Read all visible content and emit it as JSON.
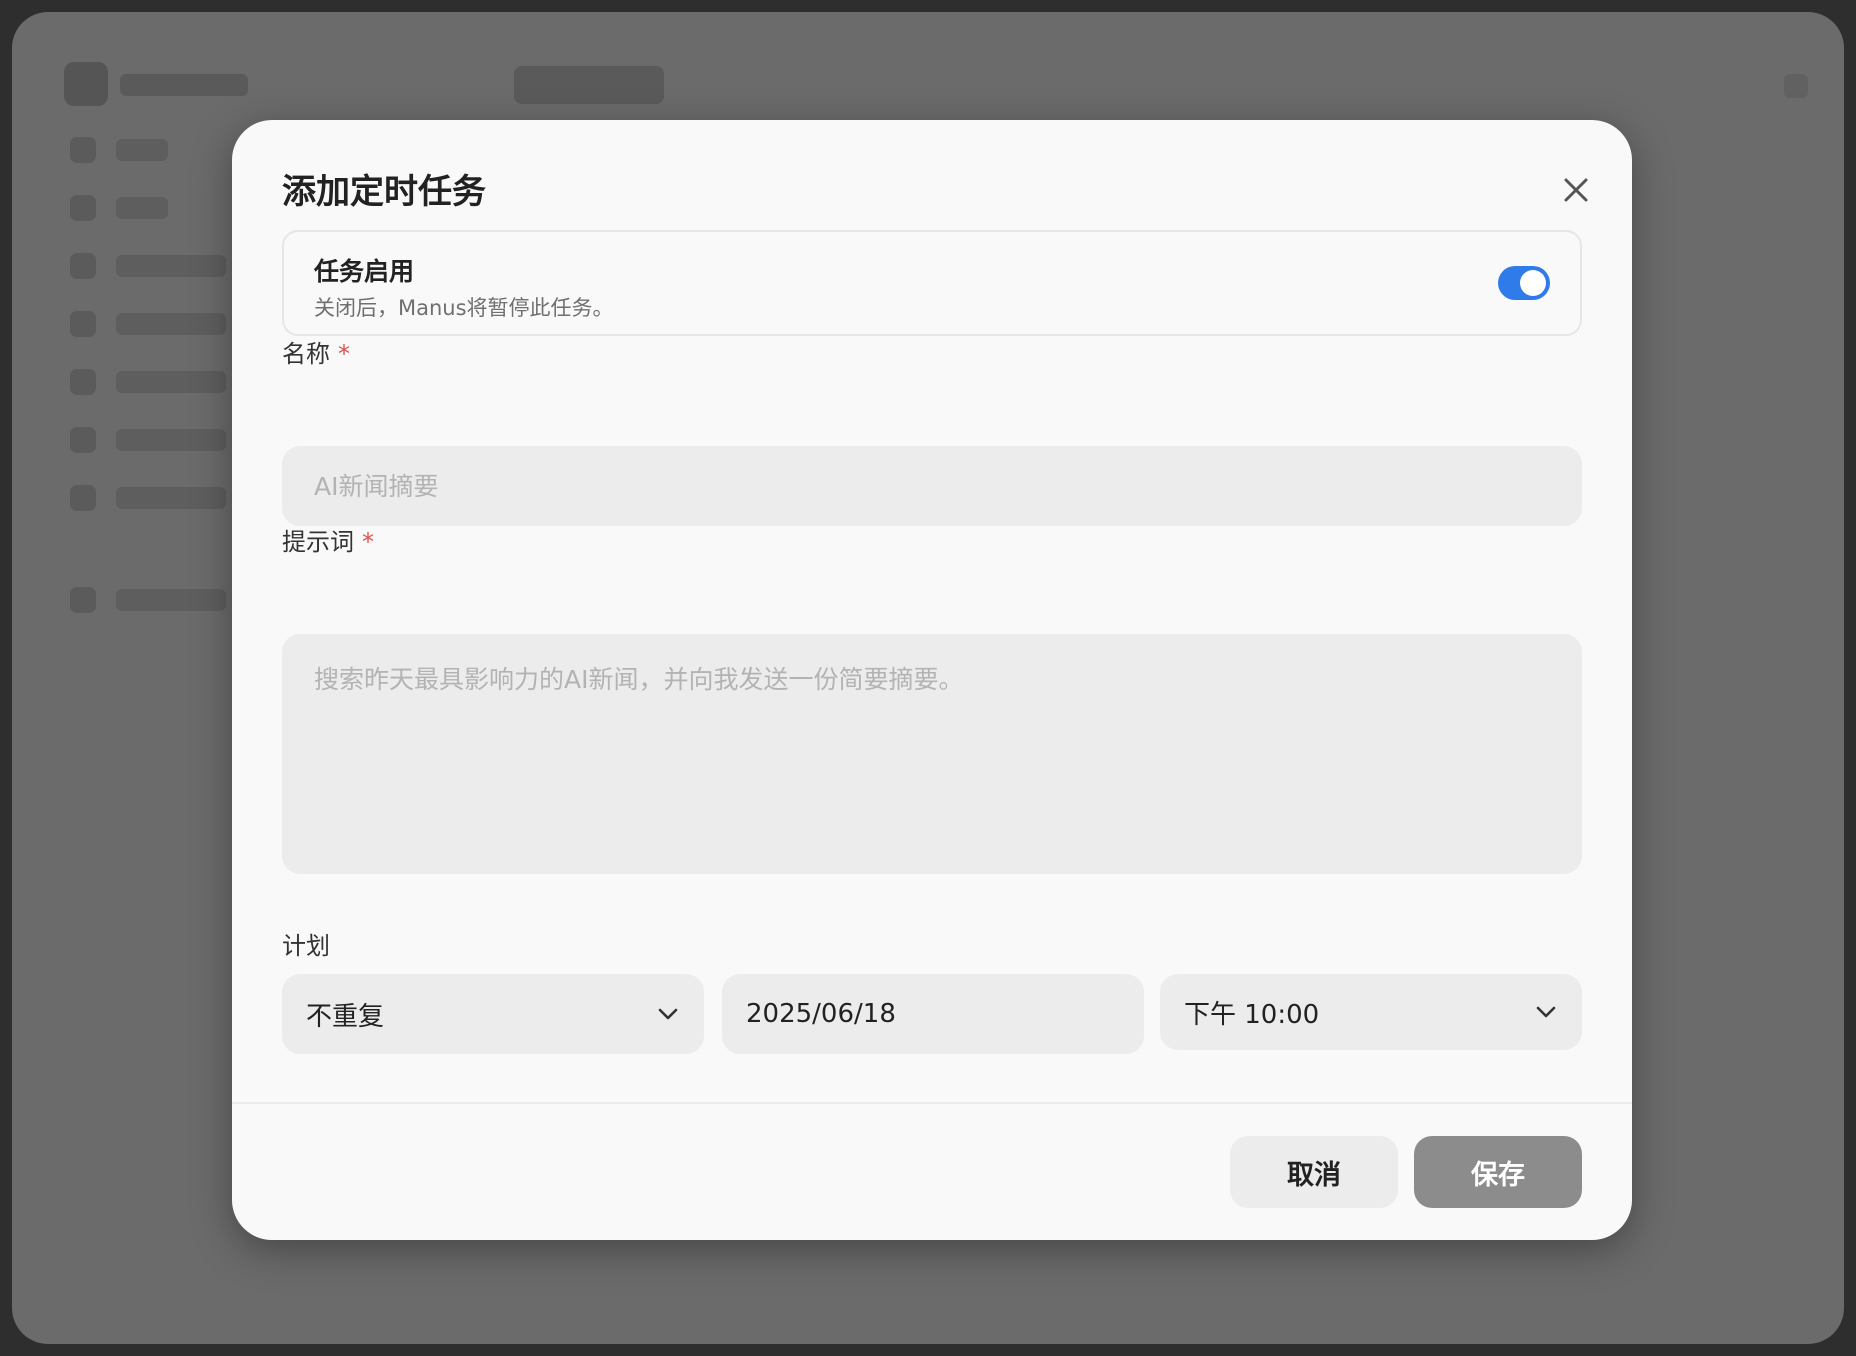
{
  "modal": {
    "title": "添加定时任务",
    "enable": {
      "title": "任务启用",
      "description": "关闭后，Manus将暂停此任务。",
      "enabled": true
    },
    "name_field": {
      "label": "名称",
      "required_mark": "*",
      "placeholder": "AI新闻摘要",
      "value": ""
    },
    "prompt_field": {
      "label": "提示词",
      "required_mark": "*",
      "placeholder": "搜索昨天最具影响力的AI新闻，并向我发送一份简要摘要。",
      "value": ""
    },
    "schedule": {
      "label": "计划",
      "repeat": "不重复",
      "date": "2025/06/18",
      "time": "下午 10:00"
    },
    "buttons": {
      "cancel": "取消",
      "save": "保存"
    }
  },
  "colors": {
    "accent": "#2f7bea",
    "required": "#d9534f",
    "save_disabled": "#8c8c8c"
  },
  "icons": {
    "close": "close-icon",
    "dropdown": "chevron-down-icon"
  }
}
